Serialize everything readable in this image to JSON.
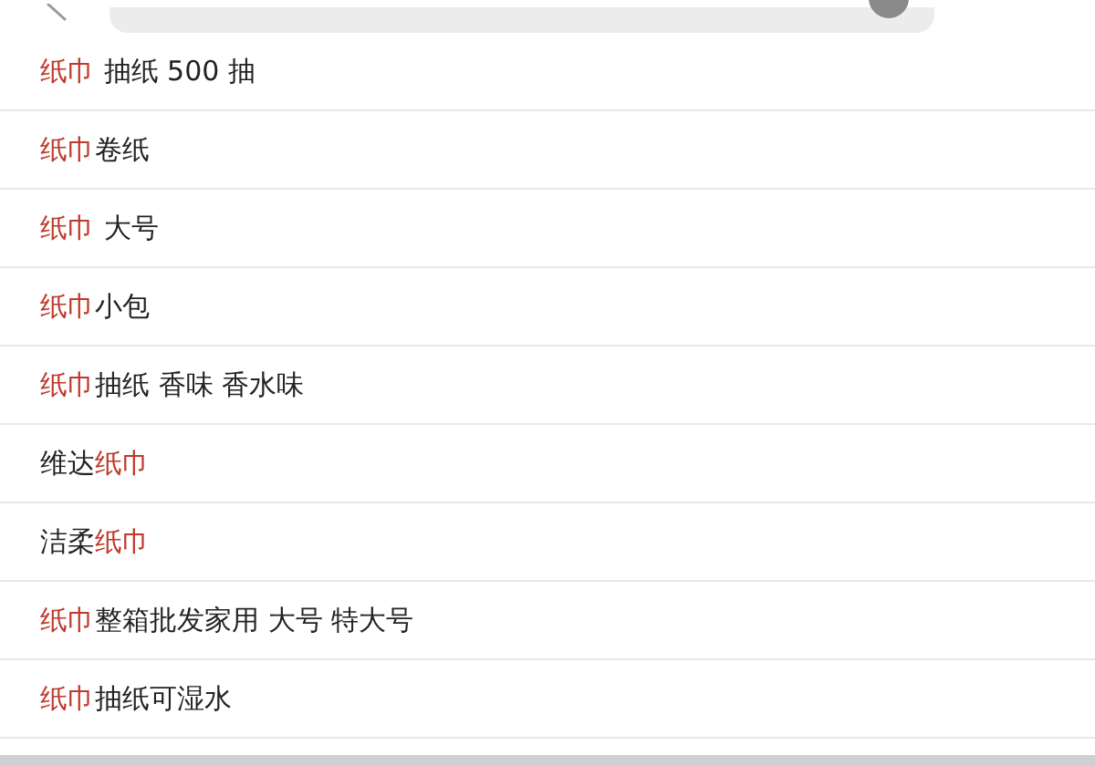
{
  "suggestions": [
    {
      "segments": [
        {
          "text": "纸巾",
          "highlight": true
        },
        {
          "text": " 抽纸 500 抽",
          "highlight": false
        }
      ]
    },
    {
      "segments": [
        {
          "text": "纸巾",
          "highlight": true
        },
        {
          "text": "卷纸",
          "highlight": false
        }
      ]
    },
    {
      "segments": [
        {
          "text": "纸巾",
          "highlight": true
        },
        {
          "text": " 大号",
          "highlight": false
        }
      ]
    },
    {
      "segments": [
        {
          "text": "纸巾",
          "highlight": true
        },
        {
          "text": "小包",
          "highlight": false
        }
      ]
    },
    {
      "segments": [
        {
          "text": "纸巾",
          "highlight": true
        },
        {
          "text": "抽纸 香味 香水味",
          "highlight": false
        }
      ]
    },
    {
      "segments": [
        {
          "text": "维达",
          "highlight": false
        },
        {
          "text": "纸巾",
          "highlight": true
        }
      ]
    },
    {
      "segments": [
        {
          "text": "洁柔",
          "highlight": false
        },
        {
          "text": "纸巾",
          "highlight": true
        }
      ]
    },
    {
      "segments": [
        {
          "text": "纸巾",
          "highlight": true
        },
        {
          "text": "整箱批发家用 大号 特大号",
          "highlight": false
        }
      ]
    },
    {
      "segments": [
        {
          "text": "纸巾",
          "highlight": true
        },
        {
          "text": "抽纸可湿水",
          "highlight": false
        }
      ]
    }
  ]
}
